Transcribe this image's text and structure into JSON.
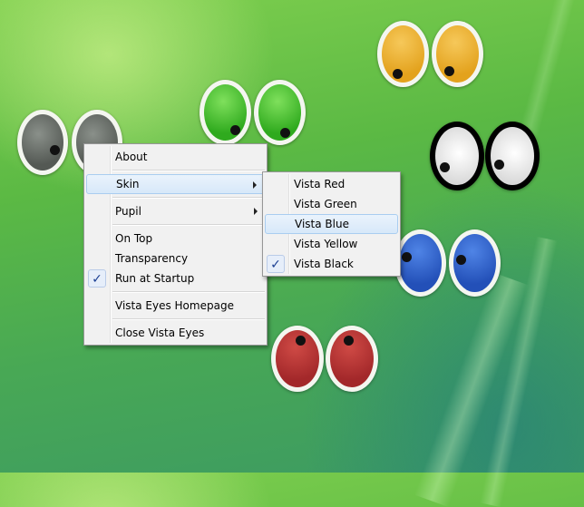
{
  "colors": {
    "gray_iris": "#545954",
    "green_iris": "#2faa1e",
    "yellow_iris": "#e3a21d",
    "blue_iris": "#2350b8",
    "red_iris": "#a3282a",
    "black_iris": "#f2f2f2",
    "menu_highlight": "#d7e8f9",
    "check_color": "#1b3f93"
  },
  "context_menu": {
    "items": [
      {
        "label": "About"
      },
      {
        "label": "Skin"
      },
      {
        "label": "Pupil"
      },
      {
        "label": "On Top"
      },
      {
        "label": "Transparency"
      },
      {
        "label": "Run at Startup",
        "checked": true
      },
      {
        "label": "Vista Eyes Homepage"
      },
      {
        "label": "Close Vista Eyes"
      }
    ],
    "highlighted": "Skin"
  },
  "skin_submenu": {
    "items": [
      {
        "label": "Vista Red"
      },
      {
        "label": "Vista Green"
      },
      {
        "label": "Vista Blue"
      },
      {
        "label": "Vista Yellow"
      },
      {
        "label": "Vista Black",
        "checked": true
      }
    ],
    "highlighted": "Vista Blue",
    "checked": "Vista Black"
  },
  "icons": {
    "check": "checkmark-icon",
    "submenu_arrow": "chevron-right-icon"
  }
}
